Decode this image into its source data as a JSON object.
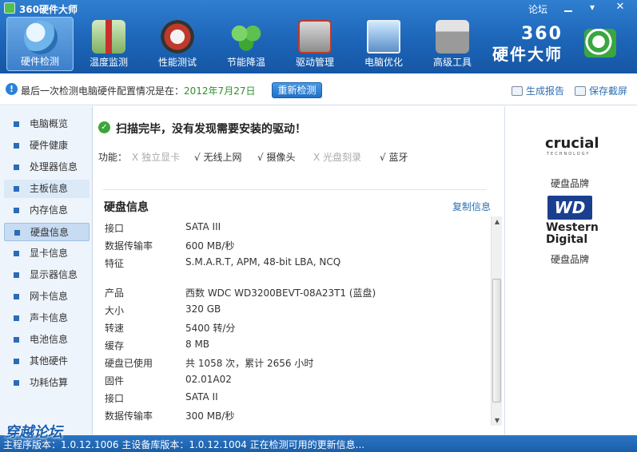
{
  "window": {
    "title": "360硬件大师",
    "forum": "论坛",
    "menu_glyph": "▾",
    "close_glyph": "✕"
  },
  "nav": [
    {
      "label": "硬件检测",
      "icon": "monitor-magnifier-icon",
      "active": true
    },
    {
      "label": "温度监测",
      "icon": "thermometer-icon"
    },
    {
      "label": "性能测试",
      "icon": "speedometer-icon"
    },
    {
      "label": "节能降温",
      "icon": "clover-icon"
    },
    {
      "label": "驱动管理",
      "icon": "driver-toolbox-icon"
    },
    {
      "label": "电脑优化",
      "icon": "optimize-monitor-icon"
    },
    {
      "label": "高级工具",
      "icon": "toolbox-icon"
    }
  ],
  "brand": {
    "number": "360",
    "name": "硬件大师"
  },
  "strip": {
    "last_text": "最后一次检测电脑硬件配置情况是在：",
    "last_date": "2012年7月27日",
    "recheck": "重新检测",
    "report": "生成报告",
    "save": "保存截屏"
  },
  "sidebar": [
    {
      "label": "电脑概览"
    },
    {
      "label": "硬件健康"
    },
    {
      "label": "处理器信息"
    },
    {
      "label": "主板信息",
      "state": "hover"
    },
    {
      "label": "内存信息"
    },
    {
      "label": "硬盘信息",
      "state": "active"
    },
    {
      "label": "显卡信息"
    },
    {
      "label": "显示器信息"
    },
    {
      "label": "网卡信息"
    },
    {
      "label": "声卡信息"
    },
    {
      "label": "电池信息"
    },
    {
      "label": "其他硬件"
    },
    {
      "label": "功耗估算"
    }
  ],
  "main": {
    "scan_msg": "扫描完毕，没有发现需要安装的驱动！",
    "func_label": "功能：",
    "functions": [
      {
        "mark": "X",
        "label": "独立显卡",
        "enabled": false
      },
      {
        "mark": "√",
        "label": "无线上网",
        "enabled": true
      },
      {
        "mark": "√",
        "label": "摄像头",
        "enabled": true
      },
      {
        "mark": "X",
        "label": "光盘刻录",
        "enabled": false
      },
      {
        "mark": "√",
        "label": "蓝牙",
        "enabled": true
      }
    ],
    "section_title": "硬盘信息",
    "copy": "复制信息",
    "rows": [
      {
        "k": "接口",
        "v": "SATA III"
      },
      {
        "k": "数据传输率",
        "v": "600 MB/秒"
      },
      {
        "k": "特征",
        "v": "S.M.A.R.T,  APM,  48-bit LBA,  NCQ"
      },
      {
        "k": "产品",
        "v": "西数 WDC WD3200BEVT-08A23T1 (蓝盘)"
      },
      {
        "k": "大小",
        "v": "320 GB"
      },
      {
        "k": "转速",
        "v": "5400 转/分"
      },
      {
        "k": "缓存",
        "v": "8 MB"
      },
      {
        "k": "硬盘已使用",
        "v": "共 1058 次，累计 2656 小时"
      },
      {
        "k": "固件",
        "v": "02.01A02"
      },
      {
        "k": "接口",
        "v": "SATA II"
      },
      {
        "k": "数据传输率",
        "v": "300 MB/秒"
      }
    ]
  },
  "right": {
    "brand1_logo": "crucial",
    "brand1_sub": "TECHNOLOGY",
    "brand1_label": "硬盘品牌",
    "brand2_logo": "WD",
    "brand2_line1": "Western",
    "brand2_line2": "Digital",
    "brand2_label": "硬盘品牌"
  },
  "status": {
    "text": "主程序版本：1.0.12.1006    主设备库版本：1.0.12.1004    正在检测可用的更新信息..."
  },
  "watermark": "穿越论坛"
}
